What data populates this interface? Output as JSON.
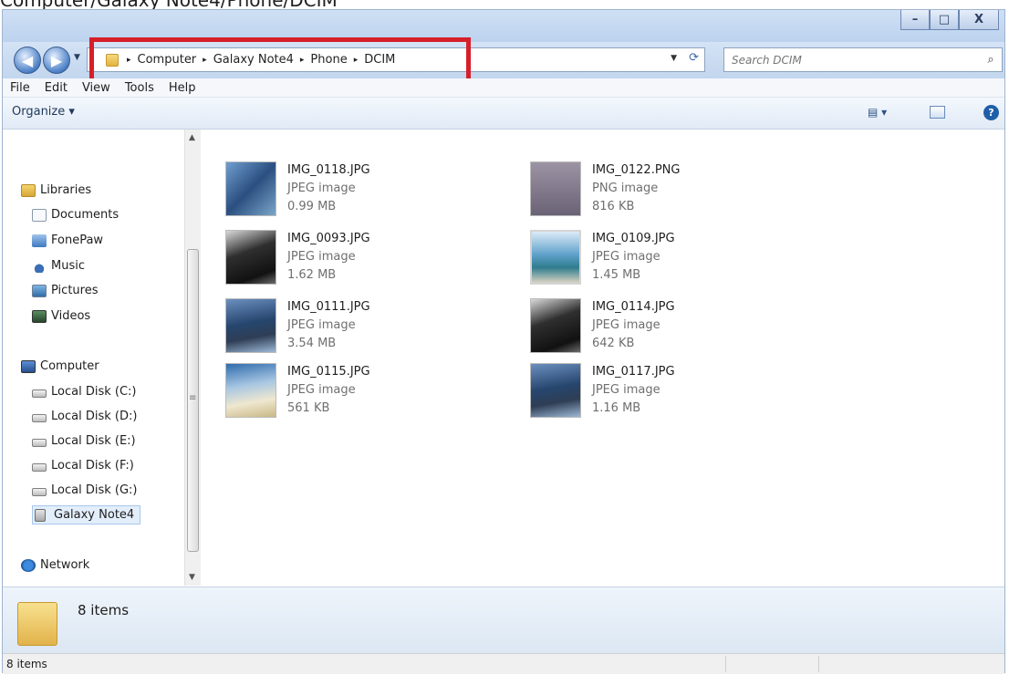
{
  "caption": "Computer/Galaxy Note4/Phone/DCIM",
  "window": {
    "controls": {
      "minimize": "–",
      "maximize": "□",
      "close": "X"
    }
  },
  "nav": {
    "back": "◀",
    "forward": "▶"
  },
  "address": {
    "crumbs": [
      "Computer",
      "Galaxy Note4",
      "Phone",
      "DCIM"
    ],
    "separator": "▸",
    "dropdown": "▼",
    "refresh": "⟳"
  },
  "search": {
    "placeholder": "Search DCIM",
    "icon": "⌕"
  },
  "menubar": [
    "File",
    "Edit",
    "View",
    "Tools",
    "Help"
  ],
  "toolbar": {
    "organize": "Organize ▾",
    "views": "▤ ▾",
    "help": "?"
  },
  "navpane": {
    "items": [
      {
        "label": "Libraries",
        "icon": "libraries-icon"
      },
      {
        "label": "Documents",
        "icon": "documents-icon"
      },
      {
        "label": "FonePaw",
        "icon": "fonepaw-icon"
      },
      {
        "label": "Music",
        "icon": "music-icon"
      },
      {
        "label": "Pictures",
        "icon": "pictures-icon"
      },
      {
        "label": "Videos",
        "icon": "videos-icon"
      },
      {
        "label": "Computer",
        "icon": "computer-icon"
      },
      {
        "label": "Local Disk (C:)",
        "icon": "disk-icon"
      },
      {
        "label": "Local Disk (D:)",
        "icon": "disk-icon"
      },
      {
        "label": "Local Disk (E:)",
        "icon": "disk-icon"
      },
      {
        "label": "Local Disk (F:)",
        "icon": "disk-icon"
      },
      {
        "label": "Local Disk (G:)",
        "icon": "disk-icon"
      },
      {
        "label": "Galaxy Note4",
        "icon": "phone-icon"
      },
      {
        "label": "Network",
        "icon": "network-icon"
      }
    ],
    "selected": "Galaxy Note4"
  },
  "files": [
    {
      "name": "IMG_0118.JPG",
      "type": "JPEG image",
      "size": "0.99 MB"
    },
    {
      "name": "IMG_0122.PNG",
      "type": "PNG image",
      "size": "816 KB"
    },
    {
      "name": "IMG_0093.JPG",
      "type": "JPEG image",
      "size": "1.62 MB"
    },
    {
      "name": "IMG_0109.JPG",
      "type": "JPEG image",
      "size": "1.45 MB"
    },
    {
      "name": "IMG_0111.JPG",
      "type": "JPEG image",
      "size": "3.54 MB"
    },
    {
      "name": "IMG_0114.JPG",
      "type": "JPEG image",
      "size": "642 KB"
    },
    {
      "name": "IMG_0115.JPG",
      "type": "JPEG image",
      "size": "561 KB"
    },
    {
      "name": "IMG_0117.JPG",
      "type": "JPEG image",
      "size": "1.16 MB"
    }
  ],
  "details": {
    "count": "8 items"
  },
  "status": {
    "count": "8 items"
  },
  "colors": {
    "highlight": "#d61f2a",
    "accent": "#2b5287"
  }
}
